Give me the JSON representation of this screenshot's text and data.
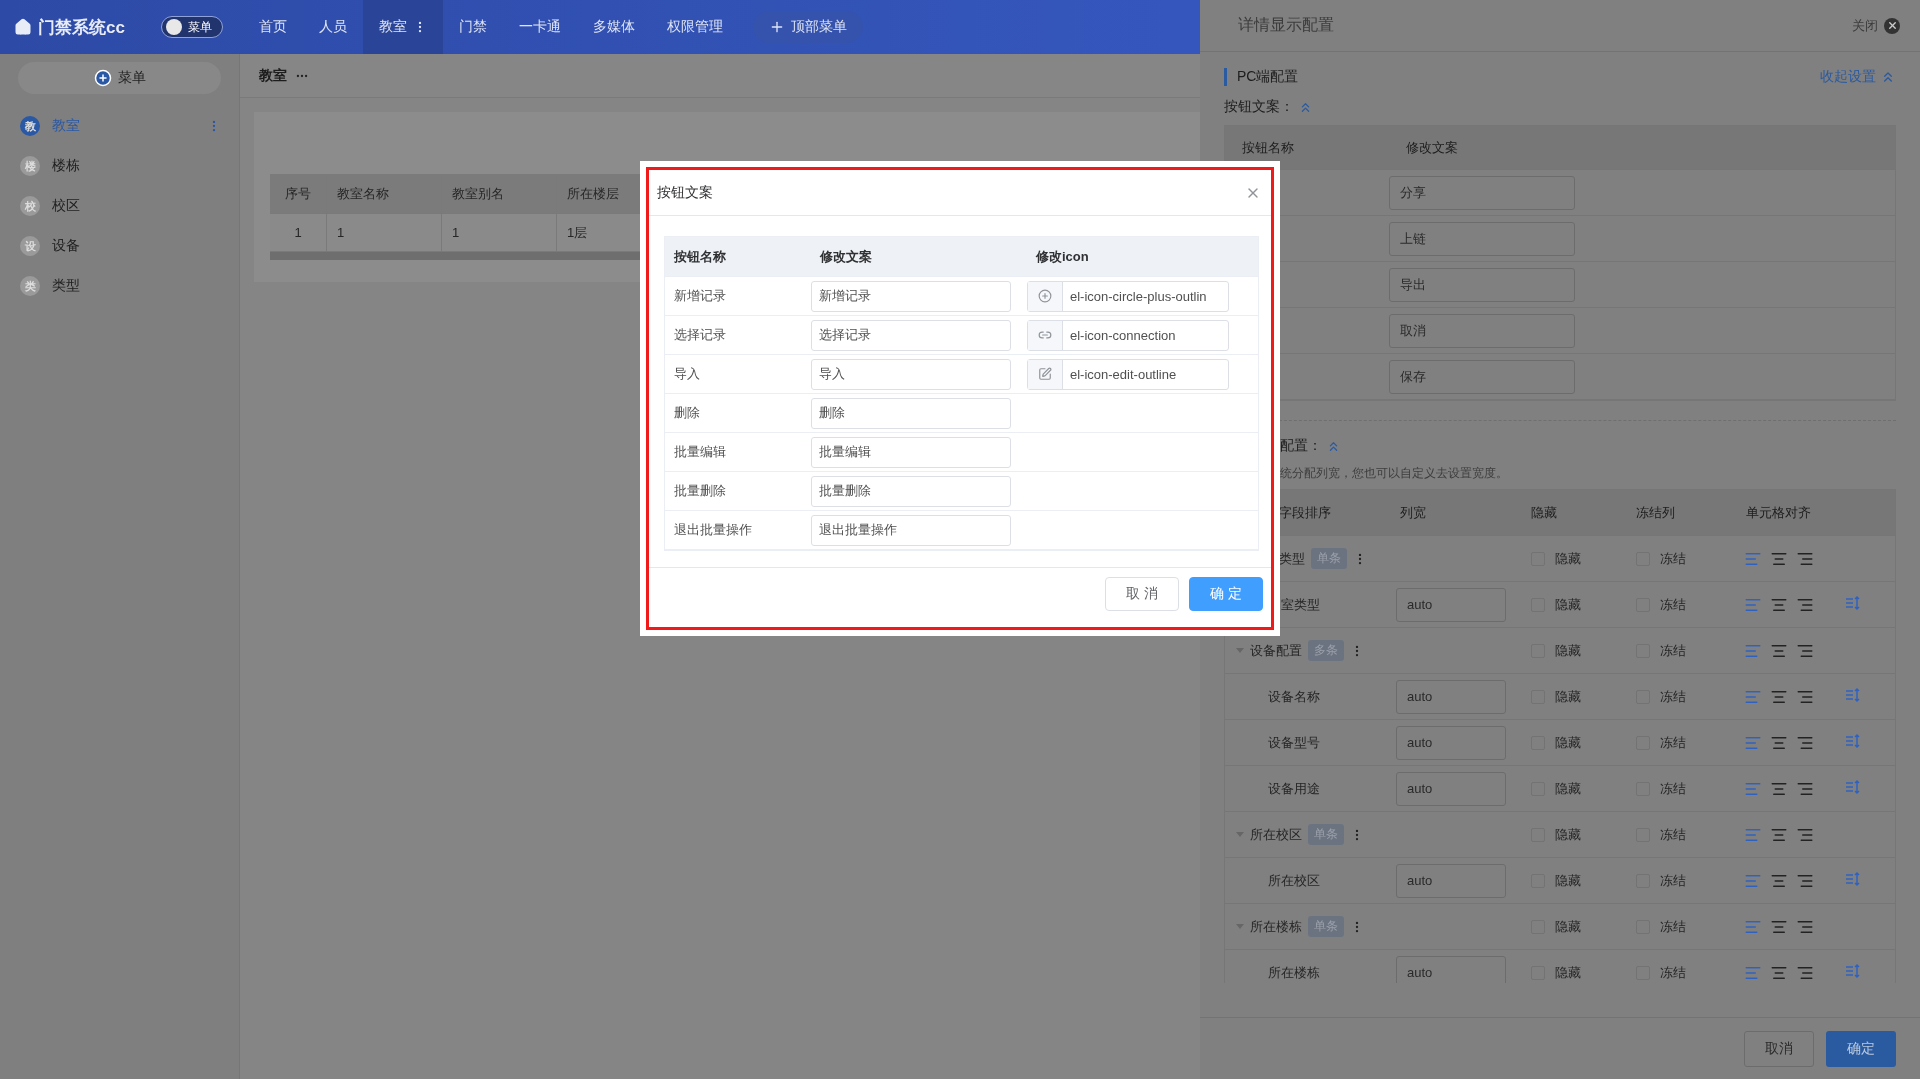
{
  "app": {
    "title": "门禁系统cc",
    "menu_switch": {
      "label": "菜单",
      "on": false
    }
  },
  "top_nav": [
    {
      "label": "首页",
      "selected": false
    },
    {
      "label": "人员",
      "selected": false
    },
    {
      "label": "教室",
      "selected": true
    },
    {
      "label": "门禁",
      "selected": false
    },
    {
      "label": "一卡通",
      "selected": false
    },
    {
      "label": "多媒体",
      "selected": false
    },
    {
      "label": "权限管理",
      "selected": false
    }
  ],
  "top_menu_button": "顶部菜单",
  "sidebar": {
    "add_button": "菜单",
    "items": [
      {
        "badge": "教",
        "label": "教室",
        "selected": true
      },
      {
        "badge": "楼",
        "label": "楼栋",
        "selected": false
      },
      {
        "badge": "校",
        "label": "校区",
        "selected": false
      },
      {
        "badge": "设",
        "label": "设备",
        "selected": false
      },
      {
        "badge": "类",
        "label": "类型",
        "selected": false
      }
    ]
  },
  "page": {
    "title": "教室"
  },
  "classroom_table": {
    "columns": [
      "序号",
      "教室名称",
      "教室别名",
      "所在楼层"
    ],
    "rows": [
      [
        "1",
        "1",
        "1",
        "1层"
      ]
    ]
  },
  "drawer": {
    "title": "详情显示配置",
    "close_label": "关闭",
    "section": "PC端配置",
    "collapse_link": "收起设置",
    "button_text": {
      "label": "按钮文案：",
      "columns": [
        "按钮名称",
        "修改文案"
      ],
      "values": [
        "分享",
        "上链",
        "导出",
        "取消",
        "保存"
      ]
    },
    "column_config": {
      "label": "配置：",
      "hint": "统分配列宽，您也可以自定义去设置宽度。",
      "columns": [
        "字段排序",
        "列宽",
        "隐藏",
        "冻结列",
        "单元格对齐"
      ],
      "rows": [
        {
          "kind": "group_clipped",
          "name": "类型",
          "tag": "单条",
          "hide_label": "隐藏",
          "hidden": false,
          "freeze_label": "冻结",
          "frozen": false,
          "left_aligned": true,
          "children": [
            {
              "kind": "field_clipped",
              "name": "室类型",
              "width": "auto",
              "hide_label": "隐藏",
              "hidden": false,
              "freeze_label": "冻结",
              "frozen": false,
              "left_aligned": true
            }
          ]
        },
        {
          "kind": "group",
          "name": "设备配置",
          "tag": "多条",
          "expanded": true,
          "hide_label": "隐藏",
          "hidden": false,
          "freeze_label": "冻结",
          "frozen": false,
          "left_aligned": true,
          "children": [
            {
              "kind": "field",
              "name": "设备名称",
              "width": "auto",
              "hide_label": "隐藏",
              "hidden": false,
              "freeze_label": "冻结",
              "frozen": false,
              "left_aligned": true
            },
            {
              "kind": "field",
              "name": "设备型号",
              "width": "auto",
              "hide_label": "隐藏",
              "hidden": false,
              "freeze_label": "冻结",
              "frozen": false,
              "left_aligned": true
            },
            {
              "kind": "field",
              "name": "设备用途",
              "width": "auto",
              "hide_label": "隐藏",
              "hidden": false,
              "freeze_label": "冻结",
              "frozen": false,
              "left_aligned": true
            }
          ]
        },
        {
          "kind": "group",
          "name": "所在校区",
          "tag": "单条",
          "expanded": true,
          "hide_label": "隐藏",
          "hidden": false,
          "freeze_label": "冻结",
          "frozen": false,
          "left_aligned": true,
          "children": [
            {
              "kind": "field",
              "name": "所在校区",
              "width": "auto",
              "hide_label": "隐藏",
              "hidden": false,
              "freeze_label": "冻结",
              "frozen": false,
              "left_aligned": true
            }
          ]
        },
        {
          "kind": "group",
          "name": "所在楼栋",
          "tag": "单条",
          "expanded": true,
          "hide_label": "隐藏",
          "hidden": false,
          "freeze_label": "冻结",
          "frozen": false,
          "left_aligned": true,
          "children": [
            {
              "kind": "field",
              "name": "所在楼栋",
              "width": "auto",
              "hide_label": "隐藏",
              "hidden": false,
              "freeze_label": "冻结",
              "frozen": false,
              "left_aligned": true
            }
          ]
        }
      ]
    },
    "footer": [
      {
        "label": "取消",
        "kind": "default"
      },
      {
        "label": "确定",
        "kind": "primary"
      }
    ]
  },
  "dialog": {
    "title": "按钮文案",
    "columns": [
      "按钮名称",
      "修改文案",
      "修改icon"
    ],
    "rows": [
      {
        "name": "新增记录",
        "text": "新增记录",
        "icon": "el-icon-circle-plus-outlin"
      },
      {
        "name": "选择记录",
        "text": "选择记录",
        "icon": "el-icon-connection"
      },
      {
        "name": "导入",
        "text": "导入",
        "icon": "el-icon-edit-outline"
      },
      {
        "name": "删除",
        "text": "删除"
      },
      {
        "name": "批量编辑",
        "text": "批量编辑"
      },
      {
        "name": "批量删除",
        "text": "批量删除"
      },
      {
        "name": "退出批量操作",
        "text": "退出批量操作"
      }
    ],
    "buttons": [
      {
        "label": "取 消",
        "kind": "default"
      },
      {
        "label": "确 定",
        "kind": "primary"
      }
    ]
  }
}
